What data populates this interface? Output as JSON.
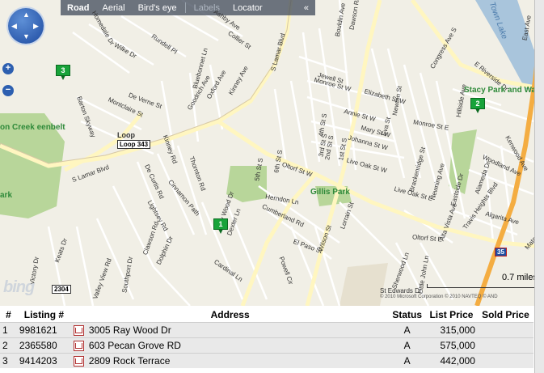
{
  "map_toolbar": {
    "tabs": [
      "Road",
      "Aerial",
      "Bird's eye",
      "Labels",
      "Locator"
    ],
    "active_tab": "Road",
    "collapse_icon": "double-chevron-left-icon"
  },
  "map_labels": {
    "streets": [
      "Homedale Dr",
      "Wilke Dr",
      "Rundell Pl",
      "Bluebonnet Ln",
      "Goodrich Ave",
      "Oxford Ave",
      "Kinney Ave",
      "Ashby Ave",
      "Collier St",
      "De Verne St",
      "Montclaire St",
      "Barton Skyway",
      "S Lamar Blvd",
      "De Curtis Rd",
      "Kinney Rd",
      "Thornton Rd",
      "Cinnamon Path",
      "Lightsey Rd",
      "Clawson Rd",
      "Dolphin Dr",
      "Ray Wood Dr",
      "Dexter Ln",
      "Cardinal Ln",
      "Southport Dr",
      "Valley View Rd",
      "Keats Dr",
      "Victory Dr",
      "Oltorf St W",
      "Herndon Ln",
      "Cumberland Rd",
      "El Paso St",
      "Powell Cir",
      "Wilson St",
      "Lorrain St",
      "Bouldin Ave",
      "Jewell St",
      "Monroe St W",
      "Elizabeth St W",
      "Annie St W",
      "Mary St W",
      "Johanna St W",
      "Live Oak St W",
      "Newton St",
      "Eva St",
      "Congress Ave S",
      "Monroe St E",
      "Brackenridge St",
      "Newning Ave",
      "Eastside Dr",
      "Alameda Dr",
      "Woodland Ave",
      "Travis Heights Blvd",
      "Algarita Ave",
      "Oltorf St E",
      "Alta Vista Ave",
      "Sherwood Ln",
      "Little John Ln",
      "Hillside Ave",
      "E Riverside Dr",
      "East Ave",
      "Kenwood Ave",
      "Mata Ave",
      "Dawson Rd",
      "St Edwards Dr",
      "Live Oak St E",
      "4th St S",
      "3rd St S",
      "2nd St S",
      "1st St S",
      "5th St S",
      "6th St S"
    ],
    "parks": [
      {
        "name": "Stacy Park and Wading Pool"
      },
      {
        "name": "Gillis Park"
      },
      {
        "name": "on Creek eenbelt"
      },
      {
        "name": "ark"
      }
    ],
    "water": "Town Lake",
    "shields": [
      "Loop 343",
      "2304",
      "35"
    ],
    "road_pink": "Loop"
  },
  "pins": [
    {
      "label": "1"
    },
    {
      "label": "2"
    },
    {
      "label": "3"
    }
  ],
  "scale_label": "0.7 miles",
  "copyright": "© 2010 Microsoft Corporation  © 2010 NAVTEQ  © AND",
  "brand": "bing",
  "table": {
    "headers": [
      "#",
      "Listing #",
      "Address",
      "Status",
      "List Price",
      "Sold Price"
    ],
    "rows": [
      {
        "num": "1",
        "listing": "9981621",
        "address": "3005 Ray Wood Dr",
        "status": "A",
        "list_price": "315,000",
        "sold_price": ""
      },
      {
        "num": "2",
        "listing": "2365580",
        "address": "603 Pecan Grove RD",
        "status": "A",
        "list_price": "575,000",
        "sold_price": ""
      },
      {
        "num": "3",
        "listing": "9414203",
        "address": "2809 Rock Terrace",
        "status": "A",
        "list_price": "442,000",
        "sold_price": ""
      }
    ]
  },
  "colors": {
    "park": "#b8d69a",
    "water": "#a9c5dc",
    "major_road": "#fff6c0",
    "highway": "#f4ad42",
    "background": "#f1efe6"
  }
}
